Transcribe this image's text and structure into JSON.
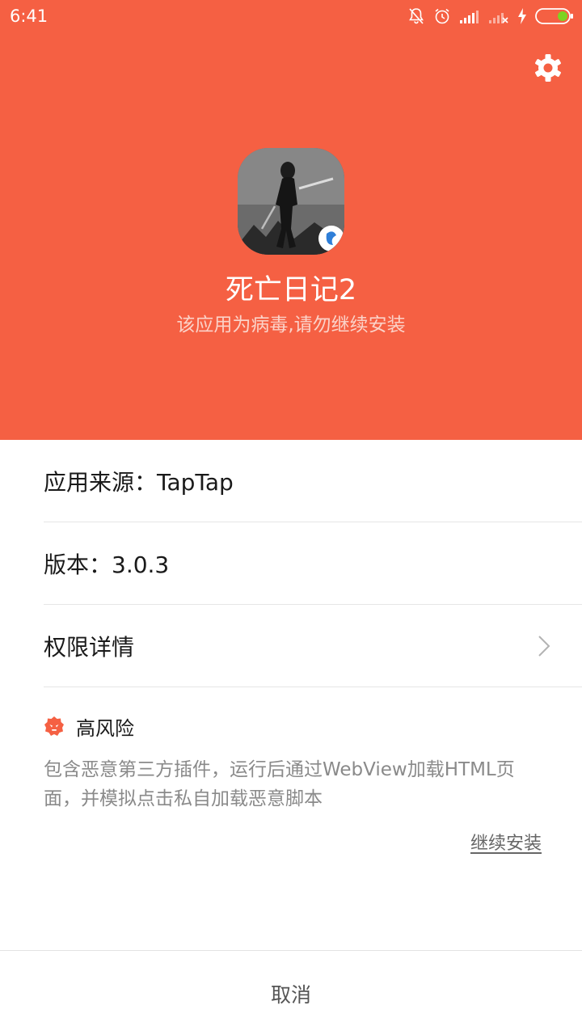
{
  "status_bar": {
    "time": "6:41",
    "icons": [
      "bell-muted-icon",
      "alarm-icon",
      "signal-icon",
      "signal-none-icon",
      "charging-icon",
      "battery-icon"
    ]
  },
  "colors": {
    "header_bg": "#f56043",
    "risk_red": "#f56043",
    "battery_level": "#7ed321"
  },
  "header": {
    "settings_icon": "gear-icon",
    "app_name": "死亡日记2",
    "warning": "该应用为病毒,请勿继续安装"
  },
  "details": {
    "source": "应用来源：TapTap",
    "version": "版本：3.0.3",
    "permissions": "权限详情",
    "permissions_icon": "chevron-right-icon"
  },
  "risk": {
    "level": "高风险",
    "icon": "warning-bug-icon",
    "description": "包含恶意第三方插件，运行后通过WebView加载HTML页面，并模拟点击私自加载恶意脚本",
    "continue_label": "继续安装"
  },
  "footer": {
    "cancel_label": "取消"
  }
}
